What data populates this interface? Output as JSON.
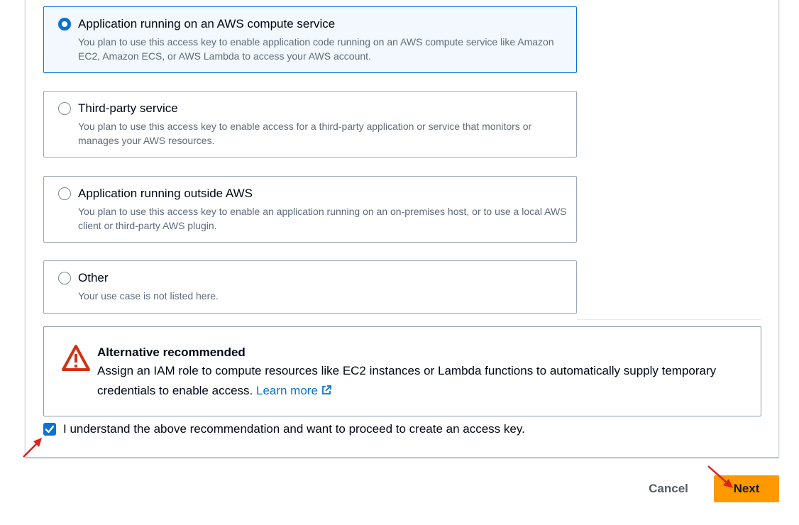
{
  "use_cases": [
    {
      "title": "Application running on an AWS compute service",
      "description": "You plan to use this access key to enable application code running on an AWS compute service like Amazon EC2, Amazon ECS, or AWS Lambda to access your AWS account.",
      "selected": true
    },
    {
      "title": "Third-party service",
      "description": "You plan to use this access key to enable access for a third-party application or service that monitors or manages your AWS resources.",
      "selected": false
    },
    {
      "title": "Application running outside AWS",
      "description": "You plan to use this access key to enable an application running on an on-premises host, or to use a local AWS client or third-party AWS plugin.",
      "selected": false
    },
    {
      "title": "Other",
      "description": "Your use case is not listed here.",
      "selected": false
    }
  ],
  "alert": {
    "icon": "warning-icon",
    "title": "Alternative recommended",
    "body": "Assign an IAM role to compute resources like EC2 instances or Lambda functions to automatically supply temporary credentials to enable access.",
    "link_label": "Learn more",
    "link_icon": "external-link-icon"
  },
  "acknowledgement": {
    "label": "I understand the above recommendation and want to proceed to create an access key.",
    "checked": true
  },
  "actions": {
    "cancel_label": "Cancel",
    "next_label": "Next"
  },
  "colors": {
    "accent": "#0972d3",
    "primary_button": "#ff9900",
    "warning": "#d13212",
    "annotation_arrow": "#e0201b"
  }
}
